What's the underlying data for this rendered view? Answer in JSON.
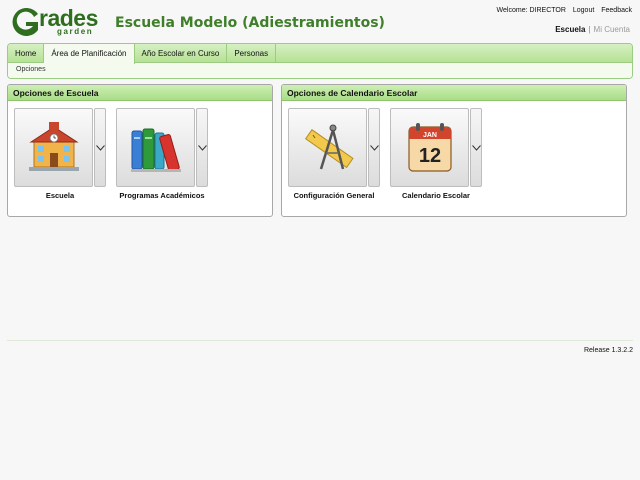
{
  "logo": {
    "mark": "G",
    "word": "rades",
    "sub": "garden"
  },
  "header": {
    "school": "Escuela Modelo (Adiestramientos)",
    "welcome": "Welcome: DIRECTOR",
    "logout": "Logout",
    "feedback": "Feedback",
    "ctx_active": "Escuela",
    "ctx_sep": "|",
    "ctx_other": "Mi Cuenta"
  },
  "nav": {
    "tabs": [
      "Home",
      "Área de Planificación",
      "Año Escolar en Curso",
      "Personas"
    ],
    "active_tab": "Área de Planificación",
    "subnav": "Opciones"
  },
  "panels": {
    "escuela": {
      "title": "Opciones de Escuela",
      "tiles": [
        {
          "label": "Escuela",
          "icon": "school-building-icon"
        },
        {
          "label": "Programas Académicos",
          "icon": "books-icon"
        }
      ]
    },
    "calendario": {
      "title": "Opciones de Calendario Escolar",
      "tiles": [
        {
          "label": "Configuración General",
          "icon": "drafting-tools-icon"
        },
        {
          "label": "Calendario Escolar",
          "icon": "calendar-icon",
          "month": "JAN",
          "day": "12"
        }
      ]
    }
  },
  "footer": {
    "release": "Release 1.3.2.2"
  },
  "colors": {
    "brand_green": "#2f6e1f",
    "title_green": "#3f7f2a",
    "header_green": "#b6e194"
  }
}
